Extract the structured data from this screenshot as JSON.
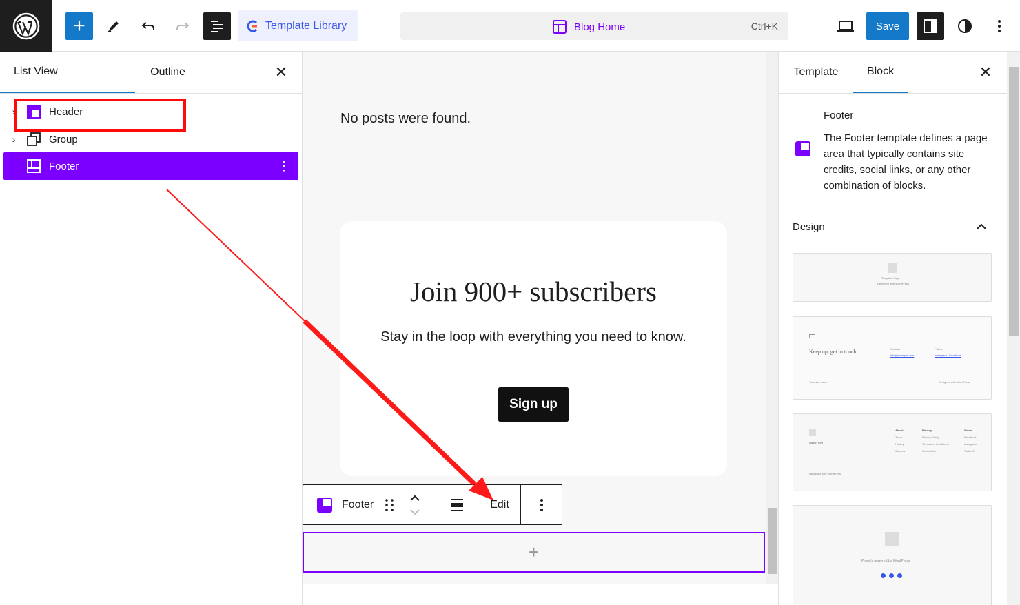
{
  "topbar": {
    "template_library_label": "Template Library",
    "command_title": "Blog Home",
    "command_shortcut": "Ctrl+K",
    "save_label": "Save",
    "accent_color": "#1479c8",
    "template_color": "#7c00ff"
  },
  "left_panel": {
    "tabs": [
      "List View",
      "Outline"
    ],
    "items": [
      {
        "label": "Header",
        "icon": "template-part-icon",
        "expandable": true
      },
      {
        "label": "Group",
        "icon": "group-icon",
        "expandable": true
      },
      {
        "label": "Footer",
        "icon": "footer-icon",
        "expandable": false,
        "selected": true
      }
    ]
  },
  "canvas": {
    "no_posts": "No posts were found.",
    "cta_heading": "Join 900+ subscribers",
    "cta_subtext": "Stay in the loop with everything you need to know.",
    "cta_button": "Sign up",
    "toolbar": {
      "block_label": "Footer",
      "edit_label": "Edit"
    },
    "append_icon": "+"
  },
  "right_panel": {
    "tabs": [
      "Template",
      "Block"
    ],
    "block_title": "Footer",
    "block_description": "The Footer template defines a page area that typically contains site credits, social links, or any other combination of blocks.",
    "design_heading": "Design",
    "patterns": [
      {
        "lines": [
          "Template Page",
          "Designed with WordPress"
        ]
      },
      {
        "heading": "Keep up, get in touch.",
        "col1_title": "Contact",
        "col1_text": "info@example.com",
        "col2_title": "Follow",
        "col2_text": "Instagram / Facebook",
        "footer_left": "Your site name",
        "footer_right": "Designed with WordPress"
      },
      {
        "brand": "Dalton Foyl",
        "cols": [
          {
            "title": "About",
            "items": [
              "Team",
              "History",
              "Careers"
            ]
          },
          {
            "title": "Privacy",
            "items": [
              "Privacy Policy",
              "Terms and Conditions",
              "Contact Us"
            ]
          },
          {
            "title": "Social",
            "items": [
              "Facebook",
              "Instagram",
              "Twitter/X"
            ]
          }
        ],
        "credit": "Designed with WordPress"
      },
      {
        "credit": "Proudly powered by WordPress"
      }
    ]
  }
}
